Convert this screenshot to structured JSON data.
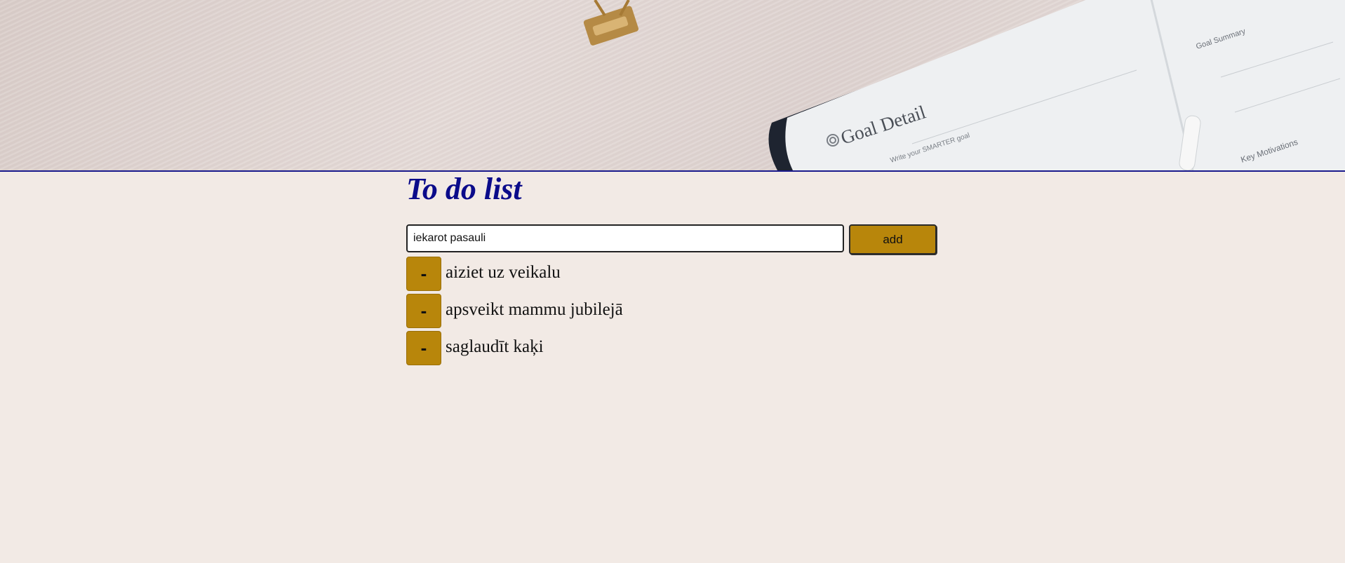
{
  "header": {
    "planner_heading": "Goal Detail",
    "planner_goal_summary": "Goal Summary",
    "planner_write_hint": "Write your SMARTER goal",
    "planner_key_motivations": "Key Motivations"
  },
  "main": {
    "title": "To do list",
    "input": {
      "value": "iekarot pasauli",
      "placeholder": ""
    },
    "add_label": "add",
    "remove_label": "-",
    "items": [
      {
        "text": "aiziet uz veikalu"
      },
      {
        "text": "apsveikt mammu jubilejā"
      },
      {
        "text": "saglaudīt kaķi"
      }
    ]
  },
  "colors": {
    "background": "#f2eae5",
    "accent": "#b8860b",
    "title": "#0b0b8a",
    "divider": "#1a1a8c"
  }
}
